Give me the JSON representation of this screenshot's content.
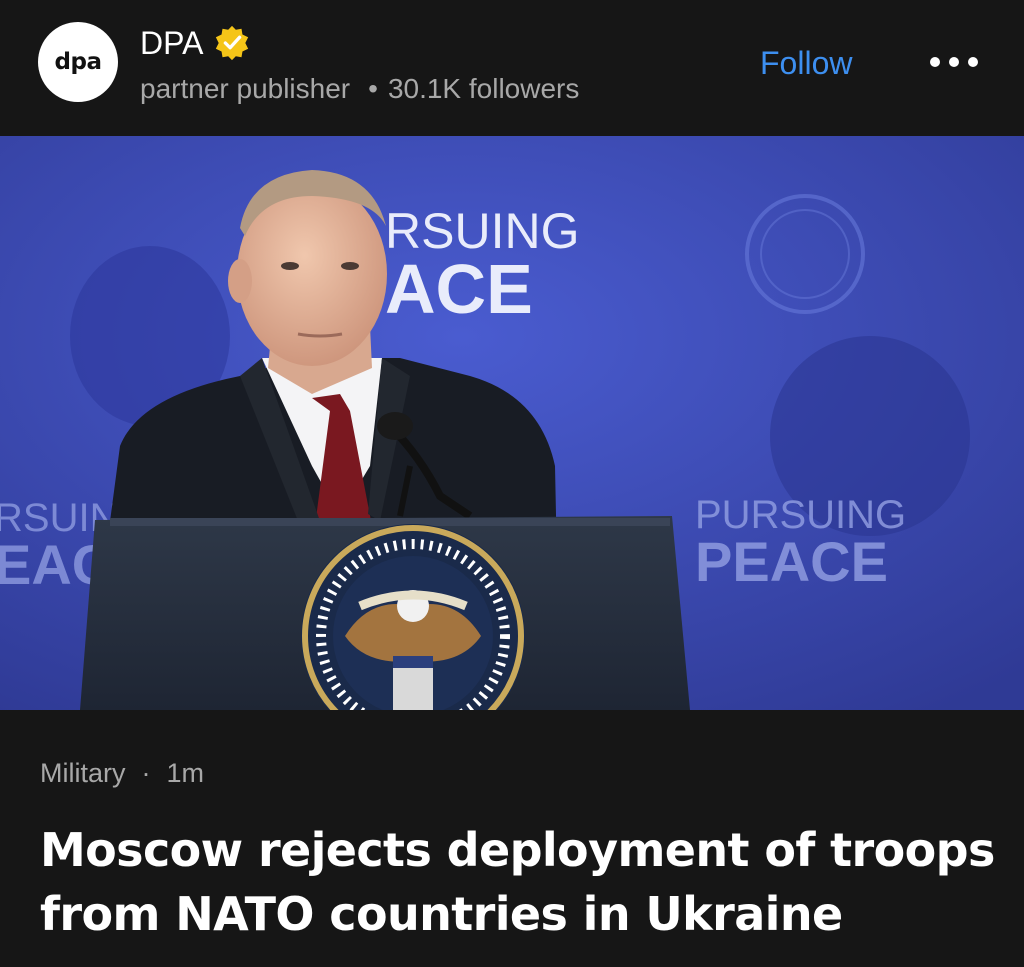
{
  "publisher": {
    "logo_text": "dpa",
    "name": "DPA",
    "verified": true,
    "verified_badge_color": "#f5c518",
    "type": "partner publisher",
    "separator": "•",
    "followers": "30.1K followers"
  },
  "actions": {
    "follow_label": "Follow",
    "follow_color": "#3d8ff0",
    "more_icon": "more-horizontal-icon"
  },
  "photo": {
    "backdrop_text_main_line1": "RSUING",
    "backdrop_text_main_line2": "ACE",
    "backdrop_text_left_line1": "RSUIN",
    "backdrop_text_left_line2": "EAC",
    "backdrop_text_right_line1": "PURSUING",
    "backdrop_text_right_line2": "PEACE",
    "backdrop_color": "#3f4fb8"
  },
  "article": {
    "category": "Military",
    "separator": "·",
    "time_ago": "1m",
    "headline": "Moscow rejects deployment of troops from NATO countries in Ukraine"
  }
}
